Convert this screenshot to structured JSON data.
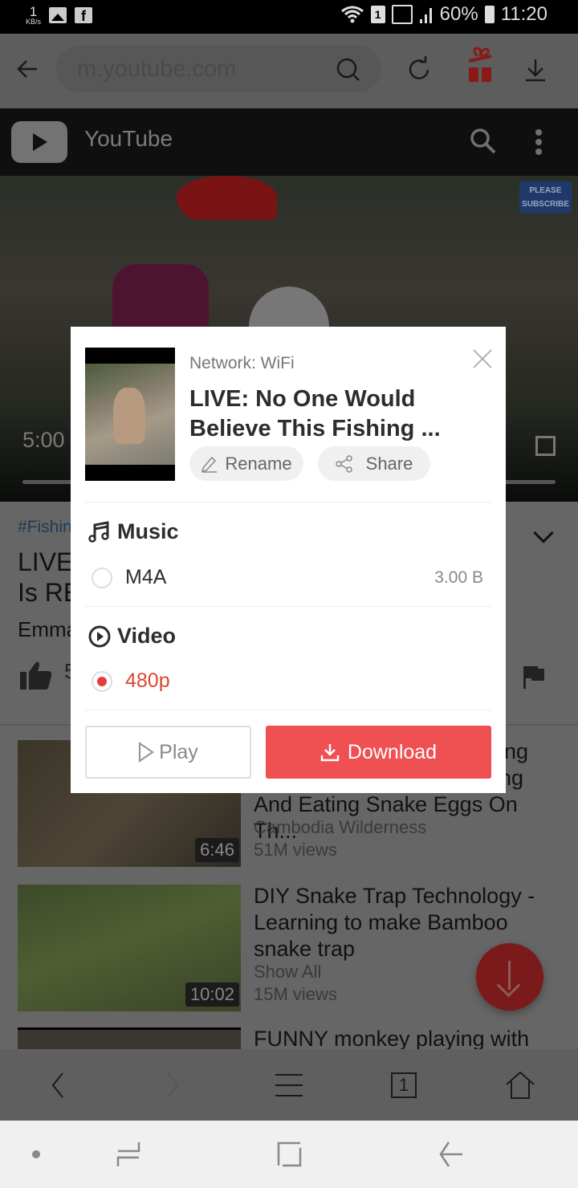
{
  "status_bar": {
    "speed_value": "1",
    "speed_unit": "KB/s",
    "notification_icons": [
      "image-icon",
      "facebook-icon"
    ],
    "sim_label": "1",
    "battery": "60%",
    "time": "11:20"
  },
  "browser": {
    "url": "m.youtube.com",
    "icons": [
      "back-arrow-icon",
      "search-icon",
      "refresh-icon",
      "gift-icon",
      "download-icon"
    ],
    "tab_count": "1",
    "gift_color": "#8a1a1a"
  },
  "youtube": {
    "title": "YouTube",
    "video_time": "5:00",
    "subscribe_badge": "PLEASE SUBSCRIBE",
    "hashtag": "#Fishing",
    "video_title": "LIVE: No One Would Believe This Fishing Is REAL",
    "video_title_visible": [
      "LIVE",
      "Is RE"
    ],
    "channel": "Emma",
    "likes_partial": "5"
  },
  "related": [
    {
      "title_tail": [
        "ling",
        "ing"
      ],
      "title": "And Eating Snake Eggs On Th...",
      "channel": "Cambodia Wilderness",
      "views": "51M views",
      "duration": "6:46"
    },
    {
      "title": "DIY Snake Trap Technology - Learning to make Bamboo snake trap",
      "channel": "Show All",
      "views": "15M views",
      "duration": "10:02"
    },
    {
      "title": "FUNNY monkey playing with"
    }
  ],
  "dialog": {
    "network": "Network: WiFi",
    "title": "LIVE: No One Would Believe This Fishing ...",
    "rename_label": "Rename",
    "share_label": "Share",
    "music_section": "Music",
    "music_options": [
      {
        "label": "M4A",
        "size": "3.00 B",
        "selected": false
      }
    ],
    "video_section": "Video",
    "video_options": [
      {
        "label": "480p",
        "selected": true
      }
    ],
    "play_label": "Play",
    "download_label": "Download",
    "accent_color": "#ef5052"
  },
  "bottom_toolbar": {
    "tab_count": "1"
  }
}
